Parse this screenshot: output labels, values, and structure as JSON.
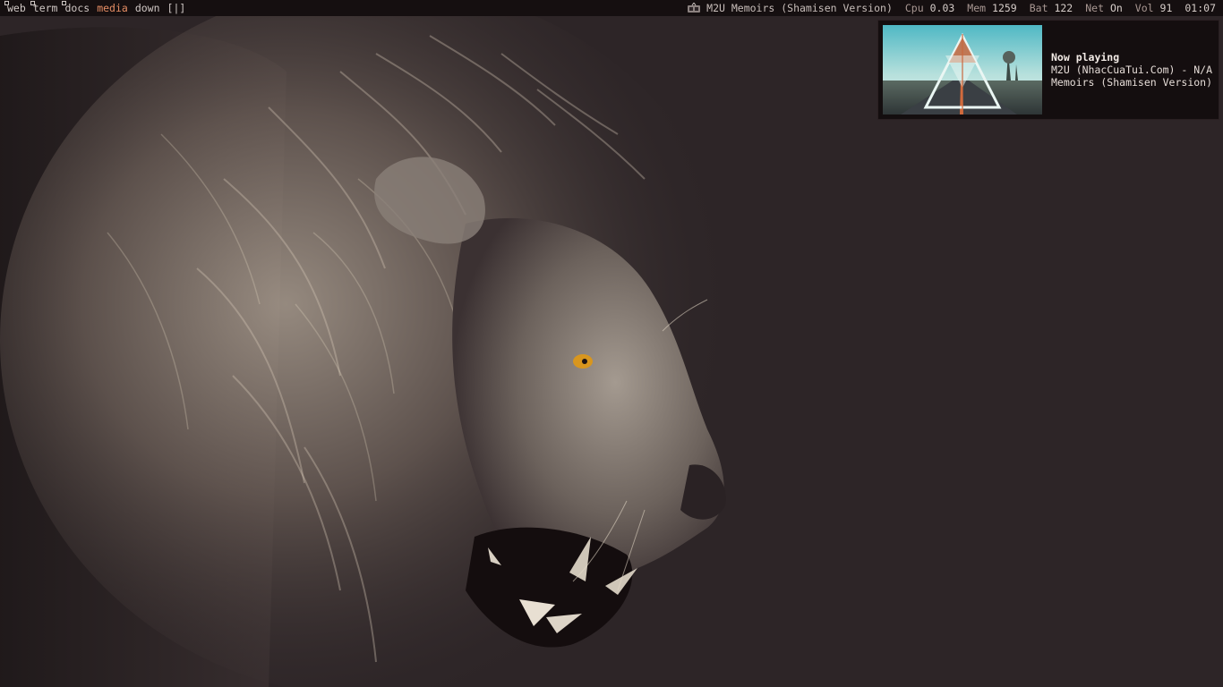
{
  "topbar": {
    "tags": [
      {
        "label": "web",
        "occupied": true,
        "active": false
      },
      {
        "label": "term",
        "occupied": true,
        "active": false
      },
      {
        "label": "docs",
        "occupied": true,
        "active": false
      },
      {
        "label": "media",
        "occupied": false,
        "active": true
      },
      {
        "label": "down",
        "occupied": false,
        "active": false
      }
    ],
    "layout_symbol": "[|]",
    "music_icon": "music-player-icon",
    "now_playing_title": "M2U Memoirs (Shamisen Version)",
    "cpu_label": "Cpu",
    "cpu_value": "0.03",
    "mem_label": "Mem",
    "mem_value": "1259",
    "bat_label": "Bat",
    "bat_value": "122",
    "net_label": "Net",
    "net_value": "On",
    "vol_label": "Vol",
    "vol_value": "91",
    "clock": "01:07"
  },
  "notification": {
    "heading": "Now playing",
    "artist_line": "M2U (NhacCuaTui.Com) - N/A",
    "track_line": "Memoirs (Shamisen Version)",
    "cover_icon": "album-art-triangle-road"
  },
  "colors": {
    "bar_bg": "#150f10",
    "accent": "#e58d64",
    "desktop_bg": "#2d2527"
  }
}
